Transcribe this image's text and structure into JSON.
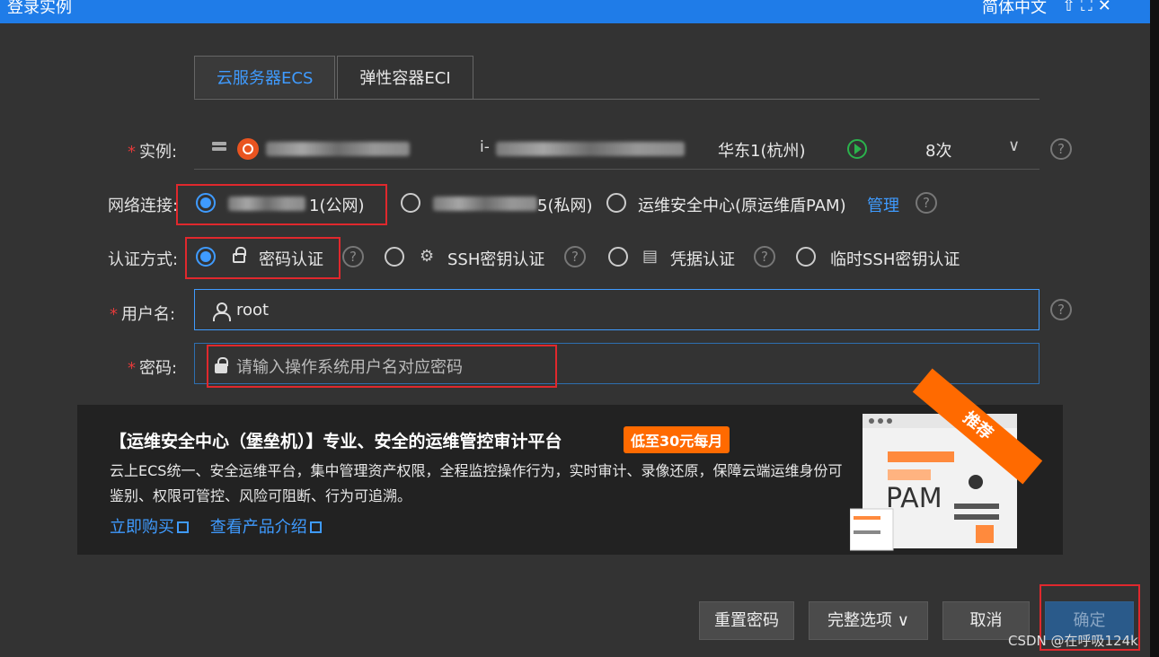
{
  "titlebar": {
    "title": "登录实例",
    "language": "简体中文",
    "icons": [
      "pin-icon",
      "expand-icon",
      "close-icon"
    ]
  },
  "tabs": [
    {
      "label": "云服务器ECS",
      "active": true
    },
    {
      "label": "弹性容器ECI",
      "active": false
    }
  ],
  "instance": {
    "label": "实例:",
    "id_prefix": "i-",
    "region": "华东1(杭州)",
    "count": "8次",
    "os_icon": "ubuntu-icon"
  },
  "network": {
    "label": "网络连接:",
    "options": [
      {
        "label": "1(公网)",
        "checked": true
      },
      {
        "label": "5(私网)",
        "checked": false
      },
      {
        "label": "运维安全中心(原运维盾PAM)",
        "checked": false
      }
    ],
    "manage_link": "管理"
  },
  "auth": {
    "label": "认证方式:",
    "options": [
      {
        "label": "密码认证",
        "checked": true,
        "icon": "lock-icon"
      },
      {
        "label": "SSH密钥认证",
        "checked": false,
        "icon": "key-icon"
      },
      {
        "label": "凭据认证",
        "checked": false,
        "icon": "credential-icon"
      },
      {
        "label": "临时SSH密钥认证",
        "checked": false
      }
    ]
  },
  "username": {
    "label": "用户名:",
    "value": "root"
  },
  "password": {
    "label": "密码:",
    "placeholder": "请输入操作系统用户名对应密码"
  },
  "banner": {
    "title": "【运维安全中心（堡垒机）】专业、安全的运维管控审计平台",
    "badge": "低至30元每月",
    "description": "云上ECS统一、安全运维平台，集中管理资产权限，全程监控操作行为，实时审计、录像还原，保障云端运维身份可鉴别、权限可管控、风险可阻断、行为可追溯。",
    "link_buy": "立即购买",
    "link_intro": "查看产品介绍",
    "ribbon": "推荐",
    "illustration_text": "PAM"
  },
  "buttons": {
    "reset_password": "重置密码",
    "full_options": "完整选项",
    "cancel": "取消",
    "confirm": "确定"
  },
  "watermark": "CSDN @在呼吸124k",
  "colors": {
    "accent": "#3f9bff",
    "titlebar": "#1f7ce8",
    "highlight": "#e0282d",
    "badge": "#ff6a00"
  }
}
